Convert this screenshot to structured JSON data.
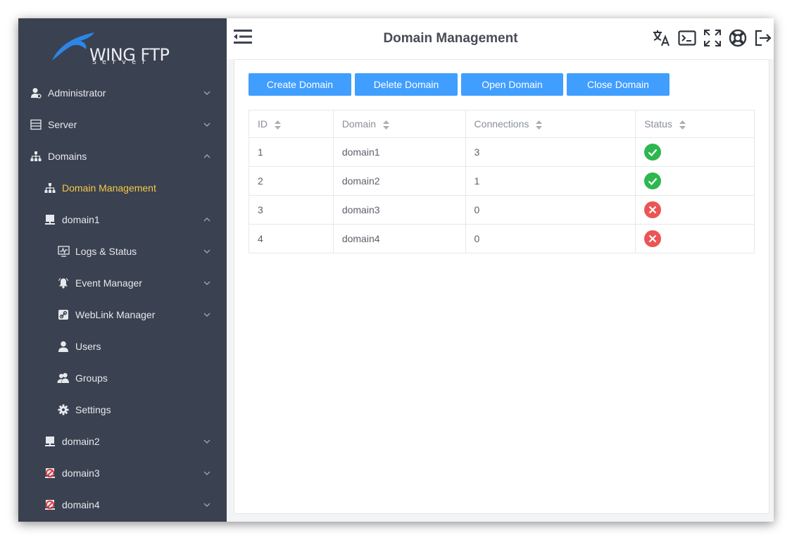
{
  "brand": {
    "name": "WING FTP",
    "sub": "Server"
  },
  "sidebar": {
    "items": [
      {
        "label": "Administrator",
        "icon": "admin-user-icon",
        "chevron": "down"
      },
      {
        "label": "Server",
        "icon": "server-icon",
        "chevron": "down"
      },
      {
        "label": "Domains",
        "icon": "domains-tree-icon",
        "chevron": "up"
      },
      {
        "label": "Domain Management",
        "icon": "domains-tree-icon",
        "active": true
      },
      {
        "label": "domain1",
        "icon": "domain-monitor-icon",
        "chevron": "up"
      },
      {
        "label": "Logs & Status",
        "icon": "logs-chart-icon",
        "chevron": "down"
      },
      {
        "label": "Event Manager",
        "icon": "bell-icon",
        "chevron": "down"
      },
      {
        "label": "WebLink Manager",
        "icon": "link-icon",
        "chevron": "down"
      },
      {
        "label": "Users",
        "icon": "user-icon"
      },
      {
        "label": "Groups",
        "icon": "group-icon"
      },
      {
        "label": "Settings",
        "icon": "gear-icon"
      },
      {
        "label": "domain2",
        "icon": "domain-monitor-icon",
        "chevron": "down"
      },
      {
        "label": "domain3",
        "icon": "domain-stopped-icon",
        "chevron": "down"
      },
      {
        "label": "domain4",
        "icon": "domain-stopped-icon",
        "chevron": "down"
      }
    ]
  },
  "header": {
    "title": "Domain Management"
  },
  "toolbar": {
    "create_label": "Create Domain",
    "delete_label": "Delete Domain",
    "open_label": "Open Domain",
    "close_label": "Close Domain"
  },
  "table": {
    "columns": [
      "ID",
      "Domain",
      "Connections",
      "Status"
    ],
    "rows": [
      {
        "id": "1",
        "domain": "domain1",
        "connections": "3",
        "status": "running"
      },
      {
        "id": "2",
        "domain": "domain2",
        "connections": "1",
        "status": "running"
      },
      {
        "id": "3",
        "domain": "domain3",
        "connections": "0",
        "status": "stopped"
      },
      {
        "id": "4",
        "domain": "domain4",
        "connections": "0",
        "status": "stopped"
      }
    ]
  },
  "colors": {
    "sidebar_bg": "#3a4150",
    "accent": "#409eff",
    "active_text": "#f7c948",
    "status_running": "#2db74e",
    "status_stopped": "#ec5454"
  }
}
